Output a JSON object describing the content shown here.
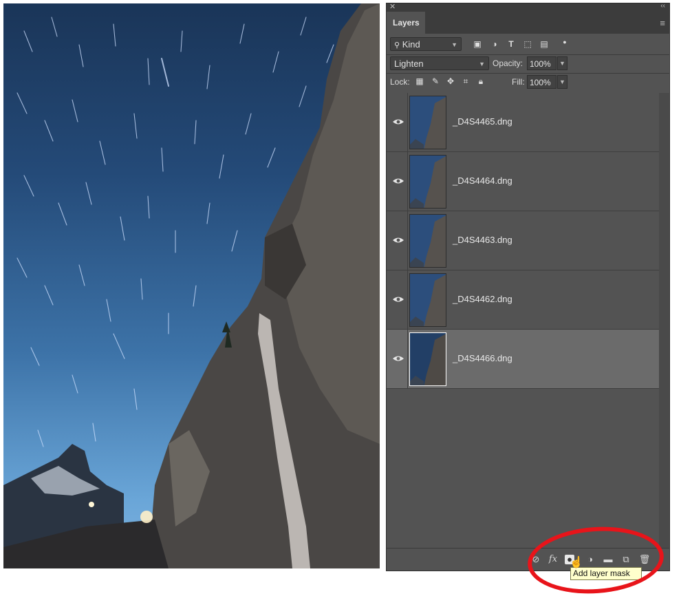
{
  "panel": {
    "tab_label": "Layers",
    "filter": {
      "label": "Kind"
    },
    "blend_mode": {
      "value": "Lighten"
    },
    "opacity": {
      "label": "Opacity:",
      "value": "100%"
    },
    "lock": {
      "label": "Lock:"
    },
    "fill": {
      "label": "Fill:",
      "value": "100%"
    },
    "layers": [
      {
        "name": "_D4S4465.dng",
        "visible": true,
        "selected": false
      },
      {
        "name": "_D4S4464.dng",
        "visible": true,
        "selected": false
      },
      {
        "name": "_D4S4463.dng",
        "visible": true,
        "selected": false
      },
      {
        "name": "_D4S4462.dng",
        "visible": true,
        "selected": false
      },
      {
        "name": "_D4S4466.dng",
        "visible": true,
        "selected": true
      }
    ],
    "footer_icons": [
      "link-icon",
      "fx-icon",
      "add-layer-mask-icon",
      "adjustment-layer-icon",
      "new-group-icon",
      "new-layer-icon",
      "delete-icon"
    ],
    "fx_label": "fx",
    "tooltip": "Add layer mask"
  },
  "colors": {
    "panel_bg": "#535353",
    "selected_row": "#6b6b6b",
    "highlight": "#e8141a",
    "tooltip_bg": "#ffffcc"
  }
}
